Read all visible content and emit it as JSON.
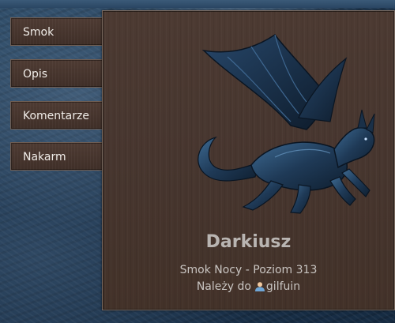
{
  "nav": {
    "items": [
      {
        "label": "Smok"
      },
      {
        "label": "Opis"
      },
      {
        "label": "Komentarze"
      },
      {
        "label": "Nakarm"
      }
    ]
  },
  "dragon": {
    "image_icon": "night-dragon-image",
    "name": "Darkiusz",
    "type_level": "Smok Nocy - Poziom 313",
    "owner_prefix": "Należy do",
    "owner_icon": "user-icon",
    "owner_name": "gilfuin"
  },
  "colors": {
    "panel": "#47362f",
    "nav_button": "#45352e",
    "background": "#1e3650",
    "dragon": "#1d3550"
  }
}
